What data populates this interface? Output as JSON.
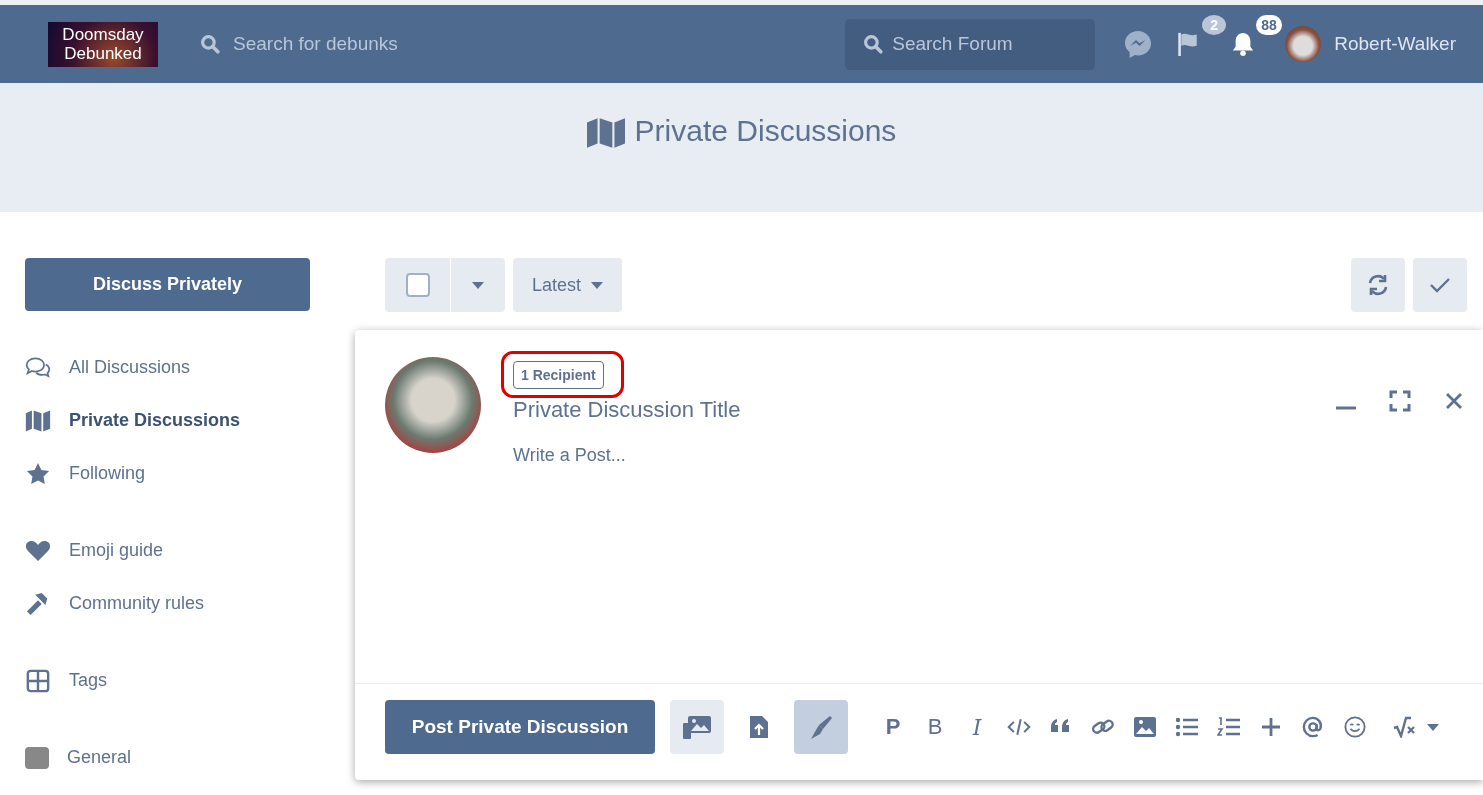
{
  "header": {
    "logo": {
      "line_1": "Doomsday",
      "line_2": "Debunked"
    },
    "search_debunks": {
      "placeholder": "Search for debunks"
    },
    "search_forum": {
      "placeholder": "Search Forum"
    },
    "flag_count": "2",
    "notification_count": "88",
    "username": "Robert-Walker"
  },
  "hero": {
    "title": "Private Discussions"
  },
  "sidebar": {
    "start_button": "Discuss Privately",
    "groups": [
      [
        {
          "kind": "comments",
          "label": "All Discussions",
          "selected": false
        },
        {
          "kind": "map",
          "label": "Private Discussions",
          "selected": true
        },
        {
          "kind": "star",
          "label": "Following",
          "selected": false
        }
      ],
      [
        {
          "kind": "heart",
          "label": "Emoji guide",
          "selected": false
        },
        {
          "kind": "gavel",
          "label": "Community rules",
          "selected": false
        }
      ],
      [
        {
          "kind": "grid",
          "label": "Tags",
          "selected": false
        }
      ],
      [
        {
          "kind": "tag",
          "label": "General",
          "selected": false,
          "color": "#888888"
        }
      ]
    ]
  },
  "toolbar": {
    "select_all": {
      "checked": false
    },
    "sort": "Latest"
  },
  "composer": {
    "recipients": "1 Recipient",
    "title": {
      "placeholder": "Private Discussion Title"
    },
    "body": {
      "placeholder": "Write a Post..."
    },
    "submit": "Post Private Discussion",
    "buttons": [
      {
        "kind": "gallery",
        "selected": false
      },
      {
        "kind": "upload",
        "selected": false
      },
      {
        "kind": "pen",
        "selected": true
      }
    ],
    "tools": [
      {
        "kind": "paragraph",
        "label": "P"
      },
      {
        "kind": "bold",
        "label": "B"
      },
      {
        "kind": "italic",
        "label": "I"
      },
      {
        "kind": "code"
      },
      {
        "kind": "quote"
      },
      {
        "kind": "link"
      },
      {
        "kind": "image"
      },
      {
        "kind": "bullets"
      },
      {
        "kind": "numbers"
      },
      {
        "kind": "plus"
      },
      {
        "kind": "mention"
      },
      {
        "kind": "emoji"
      },
      {
        "kind": "math"
      }
    ]
  }
}
